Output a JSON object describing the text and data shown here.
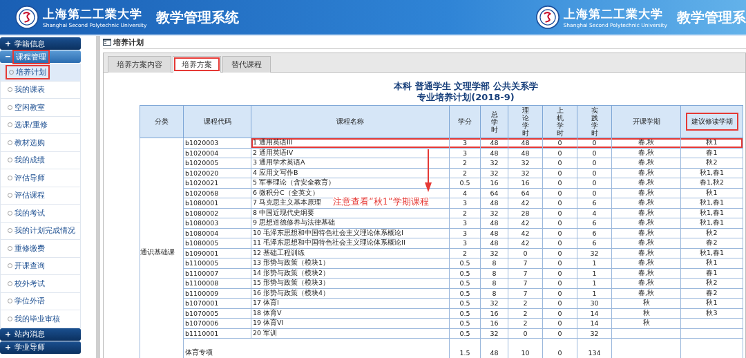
{
  "header": {
    "brands": [
      {
        "school_cn": "上海第二工業大学",
        "school_en": "Shanghai Second Polytechnic University",
        "system": "教学管理系统"
      },
      {
        "school_cn": "上海第二工業大学",
        "school_en": "Shanghai Second Polytechnic University",
        "system": "教学管理系"
      }
    ]
  },
  "sidebar": {
    "sections": [
      {
        "label": "学籍信息",
        "expanded": false,
        "highlighted": false
      },
      {
        "label": "课程管理",
        "expanded": true,
        "highlighted": true,
        "children": [
          {
            "label": "培养计划",
            "selected": true,
            "highlighted": true
          },
          {
            "label": "我的课表",
            "selected": false,
            "highlighted": false
          },
          {
            "label": "空闲教室",
            "selected": false,
            "highlighted": false
          },
          {
            "label": "选课/重修",
            "selected": false,
            "highlighted": false
          },
          {
            "label": "教材选购",
            "selected": false,
            "highlighted": false
          },
          {
            "label": "我的成绩",
            "selected": false,
            "highlighted": false
          },
          {
            "label": "评估导师",
            "selected": false,
            "highlighted": false
          },
          {
            "label": "评估课程",
            "selected": false,
            "highlighted": false
          },
          {
            "label": "我的考试",
            "selected": false,
            "highlighted": false
          },
          {
            "label": "我的计划完成情况",
            "selected": false,
            "highlighted": false
          },
          {
            "label": "重修缴费",
            "selected": false,
            "highlighted": false
          },
          {
            "label": "开课查询",
            "selected": false,
            "highlighted": false
          },
          {
            "label": "校外考试",
            "selected": false,
            "highlighted": false
          },
          {
            "label": "学位外语",
            "selected": false,
            "highlighted": false
          },
          {
            "label": "我的毕业审核",
            "selected": false,
            "highlighted": false
          }
        ]
      },
      {
        "label": "站内消息",
        "expanded": false,
        "highlighted": false
      },
      {
        "label": "学业导师",
        "expanded": false,
        "highlighted": false
      }
    ]
  },
  "page_title": "培养计划",
  "tabs": [
    {
      "label": "培养方案内容",
      "selected": false,
      "highlighted": false
    },
    {
      "label": "培养方案",
      "selected": true,
      "highlighted": true
    },
    {
      "label": "替代课程",
      "selected": false,
      "highlighted": false
    }
  ],
  "heading": {
    "line_1": "本科 普通学生 文理学部 公共关系学",
    "line_2": "专业培养计划(2018-9)"
  },
  "table": {
    "columns": [
      {
        "label": "分类",
        "vertical": false,
        "highlighted": false
      },
      {
        "label": "课程代码",
        "vertical": false,
        "highlighted": false
      },
      {
        "label": "课程名称",
        "vertical": false,
        "highlighted": false
      },
      {
        "label": "学分",
        "vertical": false,
        "highlighted": false
      },
      {
        "label": "总学时",
        "vertical": true,
        "highlighted": false
      },
      {
        "label": "理论学时",
        "vertical": true,
        "highlighted": false
      },
      {
        "label": "上机学时",
        "vertical": true,
        "highlighted": false
      },
      {
        "label": "实践学时",
        "vertical": true,
        "highlighted": false
      },
      {
        "label": "开课学期",
        "vertical": false,
        "highlighted": false
      },
      {
        "label": "建议修读学期",
        "vertical": false,
        "highlighted": true
      }
    ],
    "category": "通识基础课",
    "rows": [
      {
        "code": "b1020003",
        "name": "1 通用英语III",
        "credit": "3",
        "total": "48",
        "theory": "48",
        "computer": "0",
        "practice": "0",
        "offered": "春,秋",
        "suggested": "秋1",
        "highlighted": true
      },
      {
        "code": "b1020004",
        "name": "2 通用英语IV",
        "credit": "3",
        "total": "48",
        "theory": "48",
        "computer": "0",
        "practice": "0",
        "offered": "春,秋",
        "suggested": "春1",
        "highlighted": false
      },
      {
        "code": "b1020005",
        "name": "3 通用学术英语A",
        "credit": "2",
        "total": "32",
        "theory": "32",
        "computer": "0",
        "practice": "0",
        "offered": "春,秋",
        "suggested": "秋2",
        "highlighted": false
      },
      {
        "code": "b1020020",
        "name": "4 应用文写作B",
        "credit": "2",
        "total": "32",
        "theory": "32",
        "computer": "0",
        "practice": "0",
        "offered": "春,秋",
        "suggested": "秋1,春1",
        "highlighted": false
      },
      {
        "code": "b1020021",
        "name": "5 军事理论（含安全教育）",
        "credit": "0.5",
        "total": "16",
        "theory": "16",
        "computer": "0",
        "practice": "0",
        "offered": "春,秋",
        "suggested": "春1,秋2",
        "highlighted": false
      },
      {
        "code": "b1020068",
        "name": "6 微积分C（全英文）",
        "credit": "4",
        "total": "64",
        "theory": "64",
        "computer": "0",
        "practice": "0",
        "offered": "春,秋",
        "suggested": "秋1",
        "highlighted": false
      },
      {
        "code": "b1080001",
        "name": "7 马克思主义基本原理",
        "credit": "3",
        "total": "48",
        "theory": "42",
        "computer": "0",
        "practice": "6",
        "offered": "春,秋",
        "suggested": "秋1,春1",
        "highlighted": false
      },
      {
        "code": "b1080002",
        "name": "8 中国近现代史纲要",
        "credit": "2",
        "total": "32",
        "theory": "28",
        "computer": "0",
        "practice": "4",
        "offered": "春,秋",
        "suggested": "秋1,春1",
        "highlighted": false
      },
      {
        "code": "b1080003",
        "name": "9 思想道德修养与法律基础",
        "credit": "3",
        "total": "48",
        "theory": "42",
        "computer": "0",
        "practice": "6",
        "offered": "春,秋",
        "suggested": "秋1,春1",
        "highlighted": false
      },
      {
        "code": "b1080004",
        "name": "10 毛泽东思想和中国特色社会主义理论体系概论I",
        "credit": "3",
        "total": "48",
        "theory": "42",
        "computer": "0",
        "practice": "6",
        "offered": "春,秋",
        "suggested": "秋2",
        "highlighted": false
      },
      {
        "code": "b1080005",
        "name": "11 毛泽东思想和中国特色社会主义理论体系概论II",
        "credit": "3",
        "total": "48",
        "theory": "42",
        "computer": "0",
        "practice": "6",
        "offered": "春,秋",
        "suggested": "春2",
        "highlighted": false
      },
      {
        "code": "b1090001",
        "name": "12 基础工程训练",
        "credit": "2",
        "total": "32",
        "theory": "0",
        "computer": "0",
        "practice": "32",
        "offered": "春,秋",
        "suggested": "秋1,春1",
        "highlighted": false
      },
      {
        "code": "b1100005",
        "name": "13 形势与政策（模块1）",
        "credit": "0.5",
        "total": "8",
        "theory": "7",
        "computer": "0",
        "practice": "1",
        "offered": "春,秋",
        "suggested": "秋1",
        "highlighted": false
      },
      {
        "code": "b1100007",
        "name": "14 形势与政策（模块2）",
        "credit": "0.5",
        "total": "8",
        "theory": "7",
        "computer": "0",
        "practice": "1",
        "offered": "春,秋",
        "suggested": "春1",
        "highlighted": false
      },
      {
        "code": "b1100008",
        "name": "15 形势与政策（模块3）",
        "credit": "0.5",
        "total": "8",
        "theory": "7",
        "computer": "0",
        "practice": "1",
        "offered": "春,秋",
        "suggested": "秋2",
        "highlighted": false
      },
      {
        "code": "b1100009",
        "name": "16 形势与政策（模块4）",
        "credit": "0.5",
        "total": "8",
        "theory": "7",
        "computer": "0",
        "practice": "1",
        "offered": "春,秋",
        "suggested": "春2",
        "highlighted": false
      },
      {
        "code": "b1070001",
        "name": "17 体育I",
        "credit": "0.5",
        "total": "32",
        "theory": "2",
        "computer": "0",
        "practice": "30",
        "offered": "秋",
        "suggested": "秋1",
        "highlighted": false
      },
      {
        "code": "b1070005",
        "name": "18 体育V",
        "credit": "0.5",
        "total": "16",
        "theory": "2",
        "computer": "0",
        "practice": "14",
        "offered": "秋",
        "suggested": "秋3",
        "highlighted": false
      },
      {
        "code": "b1070006",
        "name": "19 体育VI",
        "credit": "0.5",
        "total": "16",
        "theory": "2",
        "computer": "0",
        "practice": "14",
        "offered": "秋",
        "highlighted": false
      },
      {
        "code": "b1110001",
        "name": "20 军训",
        "credit": "0.5",
        "total": "32",
        "theory": "0",
        "computer": "0",
        "practice": "32",
        "highlighted": false
      }
    ],
    "subtotal": {
      "label": "体育专项",
      "credit": "1.5",
      "total": "48",
      "theory": "10",
      "computer": "0",
      "practice": "134"
    }
  },
  "annotation": {
    "note": "注意查看“秋1”学期课程"
  }
}
